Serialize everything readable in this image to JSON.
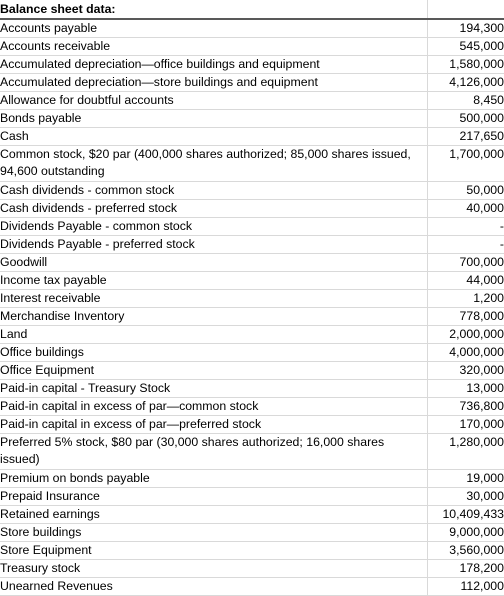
{
  "sheet": {
    "title": "Balance sheet data:",
    "header_value": "",
    "columns": [
      "Balance sheet data:",
      ""
    ],
    "rows": [
      {
        "label": "Accounts payable",
        "value": "194,300",
        "indent": false,
        "tall": false
      },
      {
        "label": "Accounts receivable",
        "value": "545,000",
        "indent": false,
        "tall": false
      },
      {
        "label": "Accumulated depreciation—office buildings and equipment",
        "value": "1,580,000",
        "indent": false,
        "tall": false
      },
      {
        "label": "Accumulated depreciation—store buildings and equipment",
        "value": "4,126,000",
        "indent": false,
        "tall": false
      },
      {
        "label": "Allowance for doubtful accounts",
        "value": "8,450",
        "indent": false,
        "tall": false
      },
      {
        "label": "Bonds payable",
        "value": "500,000",
        "indent": false,
        "tall": false
      },
      {
        "label": "Cash",
        "value": "217,650",
        "indent": false,
        "tall": false
      },
      {
        "label": "Common stock, $20 par (400,000 shares authorized; 85,000 shares issued, 94,600 outstanding",
        "value": "1,700,000",
        "indent": false,
        "tall": true
      },
      {
        "label": "Cash dividends - common stock",
        "value": "50,000",
        "indent": true,
        "tall": false
      },
      {
        "label": "Cash dividends - preferred stock",
        "value": "40,000",
        "indent": true,
        "tall": false
      },
      {
        "label": "Dividends Payable - common stock",
        "value": "-",
        "indent": false,
        "tall": false
      },
      {
        "label": "Dividends Payable - preferred stock",
        "value": "-",
        "indent": false,
        "tall": false
      },
      {
        "label": "Goodwill",
        "value": "700,000",
        "indent": false,
        "tall": false
      },
      {
        "label": "Income tax payable",
        "value": "44,000",
        "indent": false,
        "tall": false
      },
      {
        "label": "Interest receivable",
        "value": "1,200",
        "indent": false,
        "tall": false
      },
      {
        "label": "Merchandise Inventory",
        "value": "778,000",
        "indent": false,
        "tall": false
      },
      {
        "label": "Land",
        "value": "2,000,000",
        "indent": false,
        "tall": false
      },
      {
        "label": "Office buildings",
        "value": "4,000,000",
        "indent": false,
        "tall": false
      },
      {
        "label": "Office Equipment",
        "value": "320,000",
        "indent": false,
        "tall": false
      },
      {
        "label": "Paid-in capital - Treasury Stock",
        "value": "13,000",
        "indent": false,
        "tall": false
      },
      {
        "label": "Paid-in capital in excess of par—common stock",
        "value": "736,800",
        "indent": false,
        "tall": false
      },
      {
        "label": "Paid-in capital in excess of par—preferred stock",
        "value": "170,000",
        "indent": false,
        "tall": false
      },
      {
        "label": "Preferred 5% stock, $80 par (30,000 shares authorized; 16,000 shares issued)",
        "value": "1,280,000",
        "indent": false,
        "tall": true
      },
      {
        "label": "Premium on bonds payable",
        "value": "19,000",
        "indent": false,
        "tall": false
      },
      {
        "label": "Prepaid Insurance",
        "value": "30,000",
        "indent": false,
        "tall": false
      },
      {
        "label": "Retained earnings",
        "value": "10,409,433",
        "indent": false,
        "tall": false
      },
      {
        "label": "Store buildings",
        "value": "9,000,000",
        "indent": false,
        "tall": false
      },
      {
        "label": "Store Equipment",
        "value": "3,560,000",
        "indent": false,
        "tall": false
      },
      {
        "label": "Treasury stock",
        "value": "178,200",
        "indent": false,
        "tall": false
      },
      {
        "label": "Unearned Revenues",
        "value": "112,000",
        "indent": false,
        "tall": false
      }
    ]
  },
  "colors": {
    "gridline": "#d9d9d9",
    "header_rule": "#595959",
    "text": "#000000",
    "background": "#ffffff"
  }
}
